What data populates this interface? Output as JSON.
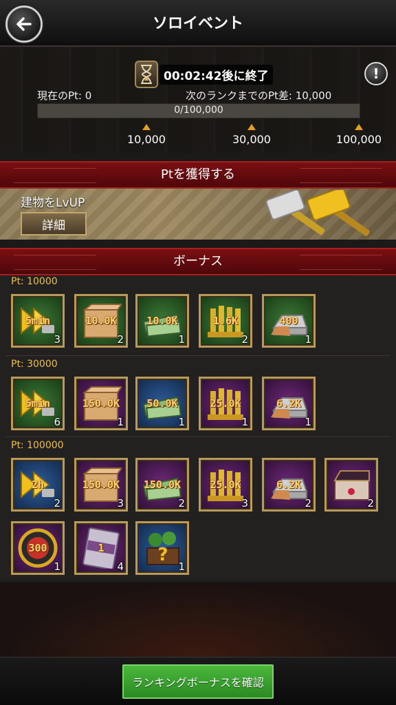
{
  "header": {
    "title": "ソロイベント"
  },
  "status": {
    "timer": "00:02:42後に終了",
    "current_pt_label": "現在のPt:",
    "current_pt_value": "0",
    "next_rank_label": "次のランクまでのPt差:",
    "next_rank_value": "10,000",
    "progress_text": "0/100,000",
    "progress_fraction": 0,
    "milestones": [
      "10,000",
      "30,000",
      "100,000"
    ]
  },
  "get_pt": {
    "banner": "Ptを獲得する",
    "task_label": "建物をLvUP",
    "detail_button": "詳細"
  },
  "bonus": {
    "banner": "ボーナス",
    "tiers": [
      {
        "label": "Pt:  10000",
        "items": [
          {
            "icon": "speedup-icon",
            "amount": "5min",
            "count": "3",
            "bg": "green"
          },
          {
            "icon": "crate-icon",
            "amount": "10.0K",
            "count": "2",
            "bg": "green"
          },
          {
            "icon": "cash-icon",
            "amount": "10.0K",
            "count": "1",
            "bg": "green"
          },
          {
            "icon": "ammo-icon",
            "amount": "1.6K",
            "count": "2",
            "bg": "green"
          },
          {
            "icon": "metal-ingot-icon",
            "amount": "400",
            "count": "1",
            "bg": "green"
          }
        ]
      },
      {
        "label": "Pt:  30000",
        "items": [
          {
            "icon": "speedup-icon",
            "amount": "5min",
            "count": "6",
            "bg": "green"
          },
          {
            "icon": "crate-icon",
            "amount": "150.0K",
            "count": "1",
            "bg": "purple"
          },
          {
            "icon": "cash-icon",
            "amount": "50.0K",
            "count": "1",
            "bg": "blue"
          },
          {
            "icon": "ammo-icon",
            "amount": "25.0K",
            "count": "1",
            "bg": "purple"
          },
          {
            "icon": "metal-ingot-icon",
            "amount": "6.2K",
            "count": "1",
            "bg": "purple"
          }
        ]
      },
      {
        "label": "Pt:  100000",
        "items": [
          {
            "icon": "speedup-icon",
            "amount": "2h",
            "count": "2",
            "bg": "blue"
          },
          {
            "icon": "crate-icon",
            "amount": "150.0K",
            "count": "3",
            "bg": "purple"
          },
          {
            "icon": "cash-icon",
            "amount": "150.0K",
            "count": "2",
            "bg": "purple"
          },
          {
            "icon": "ammo-icon",
            "amount": "25.0K",
            "count": "3",
            "bg": "purple"
          },
          {
            "icon": "metal-ingot-icon",
            "amount": "6.2K",
            "count": "2",
            "bg": "purple"
          },
          {
            "icon": "jewel-box-icon",
            "amount": "",
            "count": "2",
            "bg": "purple"
          },
          {
            "icon": "gold-coin-icon",
            "amount": "300",
            "count": "1",
            "bg": "purple"
          },
          {
            "icon": "ticket-icon",
            "amount": "1",
            "count": "4",
            "bg": "purple"
          },
          {
            "icon": "mystery-chest-icon",
            "amount": "",
            "count": "1",
            "bg": "blue"
          }
        ]
      }
    ]
  },
  "footer": {
    "ranking_button": "ランキングボーナスを確認"
  },
  "colors": {
    "banner_red": "#7a0f12",
    "gold_text": "#f0c040",
    "button_green": "#3aa02e"
  }
}
